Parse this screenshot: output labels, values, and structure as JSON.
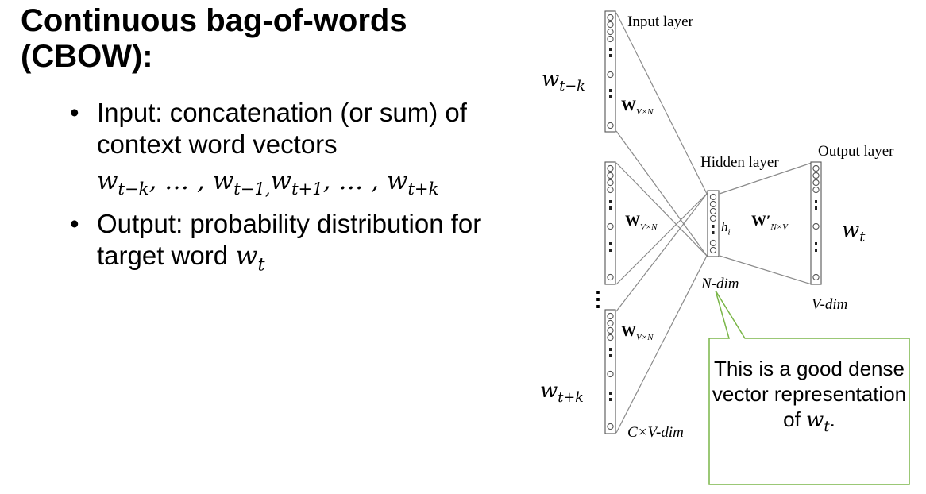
{
  "title": {
    "line1": "Continuous bag-of-words",
    "line2": "(CBOW):"
  },
  "bullets": [
    {
      "text": "Input: concatenation (or sum) of context word vectors",
      "sequence": [
        "w",
        "t−k",
        ", … , ",
        "w",
        "t−1,",
        "w",
        "t+1",
        ", … , ",
        "w",
        "t+k"
      ]
    },
    {
      "text": "Output: probability distribution for target word",
      "var": "w",
      "var_sub": "t"
    }
  ],
  "diagram": {
    "input_layer_label": "Input layer",
    "hidden_layer_label": "Hidden layer",
    "output_layer_label": "Output layer",
    "n_dim_label": "N-dim",
    "v_dim_label": "V-dim",
    "cv_dim_label": "C×V-dim",
    "input_word_top": {
      "base": "w",
      "sub": "t−k"
    },
    "input_word_bottom": {
      "base": "w",
      "sub": "t+k"
    },
    "output_word": {
      "base": "w",
      "sub": "t"
    },
    "weight_input": {
      "base": "W",
      "sub": "V×N"
    },
    "weight_output": {
      "base": "W′",
      "sub": "N×V"
    },
    "hidden_var": {
      "base": "h",
      "sub": "i"
    },
    "vertical_ellipsis": "⋮",
    "callout": {
      "text": "This is a good dense vector representation of",
      "var": "w",
      "var_sub": "t",
      "suffix": ".",
      "border_color": "#7ab648"
    }
  }
}
